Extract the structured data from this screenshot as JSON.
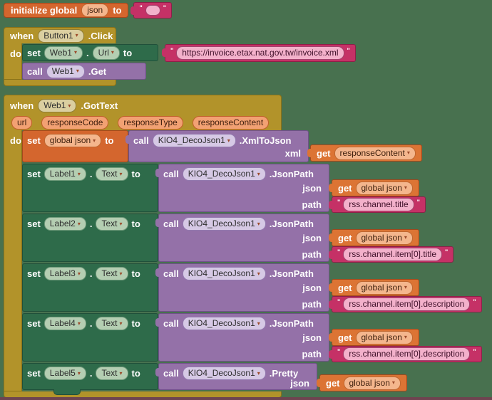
{
  "glyphs": {
    "dropdown": "▾",
    "quote": "\""
  },
  "colors": {
    "canvas": "#48714F",
    "event_gold": "#B2932A",
    "component_set_green": "#2E6B4A",
    "method_call_purple": "#9471A8",
    "variable_orange": "#D4662E",
    "text_pink": "#C53166",
    "bottom_edge": "#6E4450"
  },
  "init_block": {
    "keyword": "initialize global",
    "name": "json",
    "to": "to",
    "value": ""
  },
  "button_click": {
    "when": "when",
    "component": "Button1",
    "event": ".Click",
    "do": "do",
    "set_url": {
      "set": "set",
      "component": "Web1",
      "dot": ".",
      "property": "Url",
      "to": "to",
      "url": "https://invoice.etax.nat.gov.tw/invoice.xml"
    },
    "call_get": {
      "call": "call",
      "component": "Web1",
      "method": ".Get"
    }
  },
  "got_text": {
    "when": "when",
    "component": "Web1",
    "event": ".GotText",
    "params": [
      "url",
      "responseCode",
      "responseType",
      "responseContent"
    ],
    "do": "do",
    "xml_row": {
      "set": "set",
      "variable": "global json",
      "to": "to",
      "call": "call",
      "extension": "KIO4_DecoJson1",
      "method": ".XmlToJson",
      "param": "xml",
      "get": "get",
      "value": "responseContent"
    },
    "rows": [
      {
        "set": "set",
        "label": "Label1",
        "dot": ".",
        "property": "Text",
        "to": "to",
        "call": "call",
        "extension": "KIO4_DecoJson1",
        "method": ".JsonPath",
        "json_param": "json",
        "get": "get",
        "json_value": "global json",
        "path_param": "path",
        "path_value": "rss.channel.title"
      },
      {
        "set": "set",
        "label": "Label2",
        "dot": ".",
        "property": "Text",
        "to": "to",
        "call": "call",
        "extension": "KIO4_DecoJson1",
        "method": ".JsonPath",
        "json_param": "json",
        "get": "get",
        "json_value": "global json",
        "path_param": "path",
        "path_value": "rss.channel.item[0].title"
      },
      {
        "set": "set",
        "label": "Label3",
        "dot": ".",
        "property": "Text",
        "to": "to",
        "call": "call",
        "extension": "KIO4_DecoJson1",
        "method": ".JsonPath",
        "json_param": "json",
        "get": "get",
        "json_value": "global json",
        "path_param": "path",
        "path_value": "rss.channel.item[0].description"
      },
      {
        "set": "set",
        "label": "Label4",
        "dot": ".",
        "property": "Text",
        "to": "to",
        "call": "call",
        "extension": "KIO4_DecoJson1",
        "method": ".JsonPath",
        "json_param": "json",
        "get": "get",
        "json_value": "global json",
        "path_param": "path",
        "path_value": "rss.channel.item[0].description"
      }
    ],
    "pretty_row": {
      "set": "set",
      "label": "Label5",
      "dot": ".",
      "property": "Text",
      "to": "to",
      "call": "call",
      "extension": "KIO4_DecoJson1",
      "method": ".Pretty",
      "json_param": "json",
      "get": "get",
      "json_value": "global json"
    }
  }
}
